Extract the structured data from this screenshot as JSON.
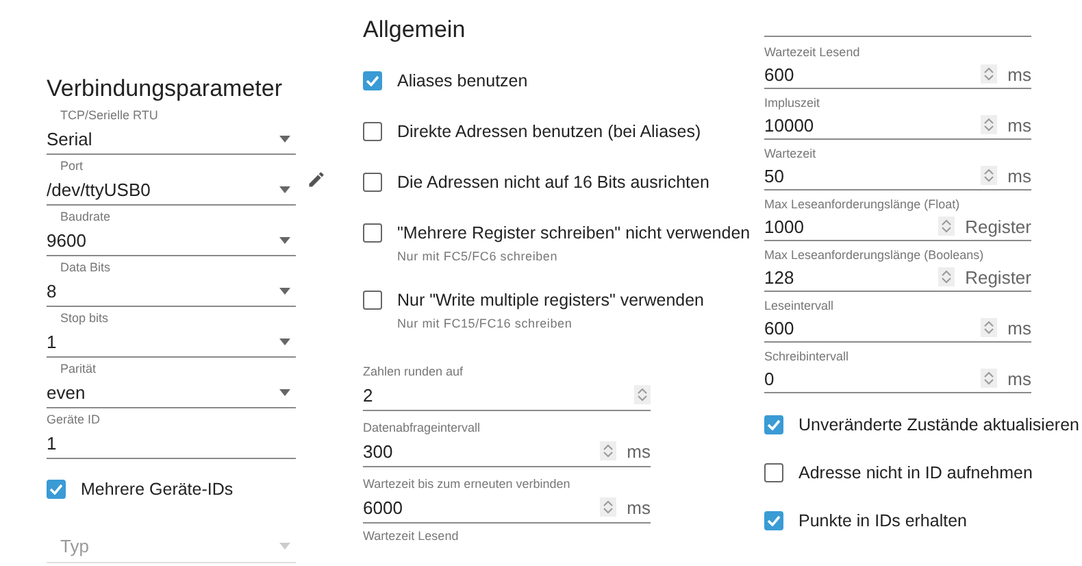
{
  "connection": {
    "title": "Verbindungsparameter",
    "fields": [
      {
        "kind": "select",
        "label": "TCP/Serielle RTU",
        "value": "Serial",
        "editable": false
      },
      {
        "kind": "select",
        "label": "Port",
        "value": "/dev/ttyUSB0",
        "editable": true
      },
      {
        "kind": "select",
        "label": "Baudrate",
        "value": "9600",
        "editable": false
      },
      {
        "kind": "select",
        "label": "Data Bits",
        "value": "8",
        "editable": false
      },
      {
        "kind": "select",
        "label": "Stop bits",
        "value": "1",
        "editable": false
      },
      {
        "kind": "select",
        "label": "Parität",
        "value": "even",
        "editable": false
      },
      {
        "kind": "text",
        "label": "Geräte ID",
        "value": "1",
        "editable": false
      }
    ],
    "option": {
      "label": "Mehrere Geräte-IDs",
      "checked": true
    },
    "type_select": {
      "label": "Typ",
      "disabled": true
    }
  },
  "general": {
    "title": "Allgemein",
    "options": [
      {
        "label": "Aliases benutzen",
        "checked": true
      },
      {
        "label": "Direkte Adressen benutzen (bei Aliases)",
        "checked": false
      },
      {
        "label": "Die Adressen nicht auf 16 Bits ausrichten",
        "checked": false
      },
      {
        "label": "\"Mehrere Register schreiben\" nicht verwenden",
        "hint": "Nur mit FC5/FC6 schreiben",
        "checked": false
      },
      {
        "label": "Nur \"Write multiple registers\" verwenden",
        "hint": "Nur mit FC15/FC16 schreiben",
        "checked": false
      }
    ],
    "number_fields": [
      {
        "label": "Zahlen runden auf",
        "value": "2"
      },
      {
        "label": "Datenabfrageintervall",
        "value": "300",
        "unit": "ms"
      },
      {
        "label": "Wartezeit bis zum erneuten verbinden",
        "value": "6000",
        "unit": "ms"
      }
    ],
    "cut_label": "Wartezeit Lesend"
  },
  "timing": {
    "number_fields": [
      {
        "label": "Wartezeit Lesend",
        "value": "600",
        "unit": "ms"
      },
      {
        "label": "Impluszeit",
        "value": "10000",
        "unit": "ms"
      },
      {
        "label": "Wartezeit",
        "value": "50",
        "unit": "ms"
      },
      {
        "label": "Max Leseanforderungslänge (Float)",
        "value": "1000",
        "unit": "Register"
      },
      {
        "label": "Max Leseanforderungslänge (Booleans)",
        "value": "128",
        "unit": "Register"
      },
      {
        "label": "Leseintervall",
        "value": "600",
        "unit": "ms"
      },
      {
        "label": "Schreibintervall",
        "value": "0",
        "unit": "ms"
      }
    ],
    "options": [
      {
        "label": "Unveränderte Zustände aktualisieren",
        "checked": true
      },
      {
        "label": "Adresse nicht in ID aufnehmen",
        "checked": false
      },
      {
        "label": "Punkte in IDs erhalten",
        "checked": true
      }
    ]
  }
}
